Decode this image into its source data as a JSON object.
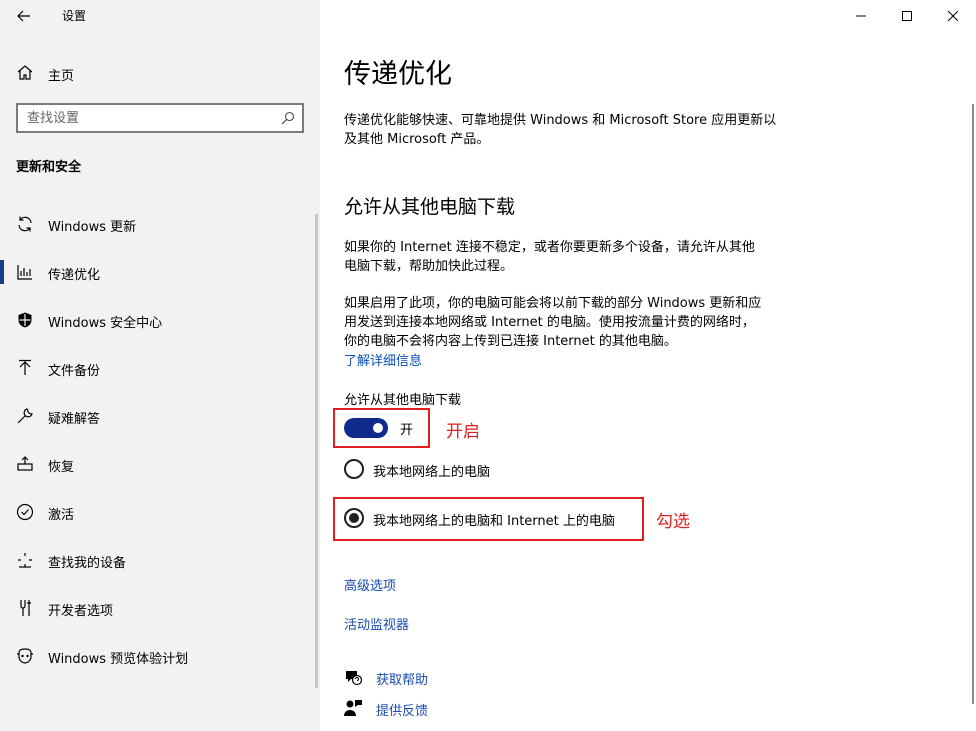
{
  "window": {
    "title": "设置"
  },
  "sidebar": {
    "home_label": "主页",
    "search_placeholder": "查找设置",
    "section_title": "更新和安全",
    "items": [
      {
        "label": "Windows 更新",
        "icon": "sync-icon",
        "selected": false
      },
      {
        "label": "传递优化",
        "icon": "delivery-optimization-icon",
        "selected": true
      },
      {
        "label": "Windows 安全中心",
        "icon": "shield-icon",
        "selected": false
      },
      {
        "label": "文件备份",
        "icon": "backup-icon",
        "selected": false
      },
      {
        "label": "疑难解答",
        "icon": "wrench-icon",
        "selected": false
      },
      {
        "label": "恢复",
        "icon": "recovery-icon",
        "selected": false
      },
      {
        "label": "激活",
        "icon": "check-circle-icon",
        "selected": false
      },
      {
        "label": "查找我的设备",
        "icon": "find-device-icon",
        "selected": false
      },
      {
        "label": "开发者选项",
        "icon": "developer-icon",
        "selected": false
      },
      {
        "label": "Windows 预览体验计划",
        "icon": "insider-icon",
        "selected": false
      }
    ]
  },
  "main": {
    "title": "传递优化",
    "description_line1": "传递优化能够快速、可靠地提供 Windows 和 Microsoft Store 应用更新以",
    "description_line2": "及其他 Microsoft 产品。",
    "subtitle": "允许从其他电脑下载",
    "para1_line1": "如果你的 Internet 连接不稳定，或者你要更新多个设备，请允许从其他",
    "para1_line2": "电脑下载，帮助加快此过程。",
    "para2_line1": "如果启用了此项，你的电脑可能会将以前下载的部分 Windows 更新和应",
    "para2_line2": "用发送到连接本地网络或 Internet 的电脑。使用按流量计费的网络时，",
    "para2_line3": "你的电脑不会将内容上传到已连接 Internet 的其他电脑。",
    "learn_more": "了解详细信息",
    "toggle_label": "允许从其他电脑下载",
    "toggle_state": "开",
    "toggle_on": true,
    "radio_local": "我本地网络上的电脑",
    "radio_internet": "我本地网络上的电脑和 Internet 上的电脑",
    "selected_radio": "internet",
    "advanced_link": "高级选项",
    "activity_link": "活动监视器",
    "get_help": "获取帮助",
    "feedback": "提供反馈"
  },
  "annotations": {
    "toggle_note": "开启",
    "radio_note": "勾选",
    "color": "#e02020"
  },
  "colors": {
    "sidebar_bg": "#f2f2f2",
    "accent": "#0f2b8c",
    "link": "#1a4bb0"
  }
}
